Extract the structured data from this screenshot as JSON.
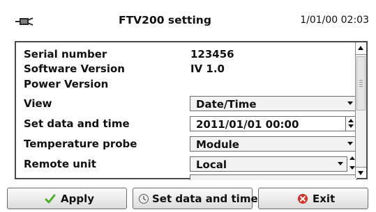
{
  "header": {
    "app_icon": "connector-plug-icon",
    "title": "FTV200 setting",
    "datetime": "1/01/00 02:03"
  },
  "settings": {
    "serial_number": {
      "label": "Serial number",
      "value": "123456"
    },
    "software_version": {
      "label": "Software Version",
      "value": "IV 1.0"
    },
    "power_version": {
      "label": "Power Version",
      "value": ""
    },
    "view": {
      "label": "View",
      "value": "Date/Time"
    },
    "set_date_time": {
      "label": "Set data and time",
      "value": "2011/01/01 00:00"
    },
    "temperature_probe": {
      "label": "Temperature probe",
      "value": "Module"
    },
    "remote_unit": {
      "label": "Remote unit",
      "value": "Local"
    }
  },
  "footer": {
    "apply_label": "Apply",
    "apply_icon": "checkmark-icon",
    "set_date_time_label": "Set data and time",
    "set_date_time_icon": "clock-icon",
    "exit_label": "Exit",
    "exit_icon": "red-close-icon"
  },
  "colors": {
    "checkmark": "#4caf28",
    "exit_icon": "#d9302a",
    "border": "#4a4a4a"
  }
}
